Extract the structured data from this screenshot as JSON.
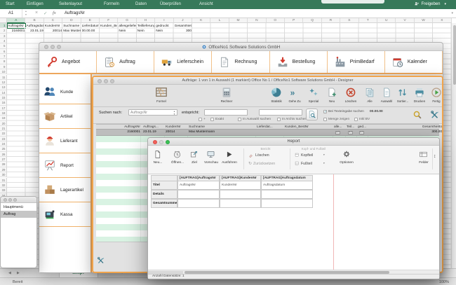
{
  "colors": {
    "ribbon_green": "#37795a",
    "accent_orange": "#f0a44c",
    "mint_stripe": "#d9f3e3",
    "excel_green": "#1e7145",
    "selection_gray": "#bdbdbd",
    "icon_teal": "#4a8da1",
    "page_guide_pink": "#f1b7b7"
  },
  "excel": {
    "ribbon_tabs": [
      "Start",
      "Einfügen",
      "Seitenlayout",
      "Formeln",
      "Daten",
      "Überprüfen",
      "Ansicht"
    ],
    "share_label": "Freigeben",
    "name_box": "A1",
    "formula_cancel": "×",
    "formula_enter": "✓",
    "formula_fx": "fx",
    "formula_value": "AuftragsNr",
    "columns": [
      "A",
      "B",
      "C",
      "D",
      "E",
      "F",
      "G",
      "H",
      "I",
      "J",
      "K",
      "L",
      "M",
      "N",
      "O",
      "P",
      "Q",
      "R",
      "S",
      "T",
      "U",
      "V",
      "W",
      "X"
    ],
    "row_count": 48,
    "sheet_header_row": [
      "AuftragsNr",
      "Auftragsdatu",
      "KundenNr",
      "Suchname",
      "Lieferdatum",
      "Kunden_Bes",
      "allesgeliefert",
      "Teillieferung",
      "gedruckt",
      "GesamtNetto"
    ],
    "sheet_data_row": [
      "2160001",
      "23.01.19",
      "20014",
      "Max Muster",
      "00.00.00",
      "",
      "Nein",
      "Nein",
      "Nein",
      "300"
    ],
    "sheet_tab": "temp7",
    "nav_prev": "◀",
    "nav_next": "▶",
    "add_sheet": "+",
    "status_ready": "Bereit",
    "zoom_level": "100%"
  },
  "main_window": {
    "title": "OfficeNo1 Software Solutions GmbH",
    "toolbar": [
      {
        "label": "Angebot",
        "icon": "key-icon"
      },
      {
        "label": "Auftrag",
        "icon": "clipboard-icon"
      },
      {
        "label": "Lieferschein",
        "icon": "truck-icon"
      },
      {
        "label": "Rechnung",
        "icon": "document-icon"
      },
      {
        "label": "Bestellung",
        "icon": "inbox-down-icon"
      },
      {
        "label": "PrimBedarf",
        "icon": "factory-icon"
      },
      {
        "label": "Kalender",
        "icon": "calendar-icon"
      }
    ],
    "sidebar": [
      {
        "label": "Kunde",
        "icon": "people-icon"
      },
      {
        "label": "Artikel",
        "icon": "open-box-icon"
      },
      {
        "label": "Lieferant",
        "icon": "person-cap-icon"
      },
      {
        "label": "Report",
        "icon": "chart-icon"
      },
      {
        "label": "Lagerartikel",
        "icon": "boxes-icon"
      },
      {
        "label": "Kassa",
        "icon": "cash-register-icon"
      }
    ]
  },
  "orders_window": {
    "title": "Aufträge: 1 von 1 in Auswahl  (1 markiert) Office No 1 /  OfficeNo1 Software Solutions GmbH - Designer",
    "toolbar_main": [
      {
        "label": "Formel",
        "icon": "abacus-icon"
      },
      {
        "label": "Rechner",
        "icon": "calculator-icon"
      }
    ],
    "toolbar_actions": [
      {
        "label": "Statistik",
        "icon": "pie-chart-icon"
      },
      {
        "label": "Gehe Zu",
        "icon": "goto-icon"
      },
      {
        "label": "Spezial",
        "icon": "stars-icon"
      },
      {
        "label": "Neu",
        "icon": "new-page-icon"
      },
      {
        "label": "Löschen",
        "icon": "delete-circle-icon"
      },
      {
        "label": "Alle",
        "icon": "pages-icon"
      },
      {
        "label": "Auswahl",
        "icon": "page-icon"
      },
      {
        "label": "Sortier...",
        "icon": "sort-icon"
      },
      {
        "label": "Drucken",
        "icon": "printer-icon"
      },
      {
        "label": "Fertig",
        "icon": "done-icon"
      }
    ],
    "search": {
      "label": "Suchen nach:",
      "field": "AuftragsNr",
      "operator": "entspricht:",
      "checks": [
        "+",
        "Exakt",
        "In Auswahl suchen",
        "In Archiv suchen"
      ],
      "opt_text_search": "Bei Texteingabe suchen",
      "opt_text_value": "00.00.00",
      "opt_menge": "Menge zeigen",
      "opt_inkl": "Inkl BV"
    },
    "table": {
      "headers": [
        "AuftragsNr",
        "Auftrags...",
        "KundenNr",
        "Suchname",
        "Lieferdat...",
        "Kunden_BestNr",
        "alle...",
        "Teil...",
        "ged...",
        "GesamtNetto"
      ],
      "row": [
        "2160001",
        "23.01.19",
        "20014",
        "Max Mustermann",
        "",
        "",
        "",
        "",
        "",
        "300,00"
      ]
    }
  },
  "report_window": {
    "title": "Report",
    "toolbar": [
      {
        "label": "Neu...",
        "icon": "new-doc-icon"
      },
      {
        "label": "Öffnen...",
        "icon": "clock-icon"
      },
      {
        "label": "Ziel",
        "icon": "target-icon"
      },
      {
        "label": "Vorschau",
        "icon": "monitor-icon"
      },
      {
        "label": "Ausführen",
        "icon": "run-icon"
      }
    ],
    "group_report": {
      "label": "Bericht",
      "item_delete": "Löschen",
      "item_reset": "Zurücksetzen"
    },
    "group_headfoot": {
      "label": "Kopf- und Fußteil",
      "item_head": "Kopfteil",
      "item_foot": "Fußteil"
    },
    "options_label": "Optionen",
    "fields_label": "Felder",
    "grid": {
      "headers": [
        "[AUFTRAG]AuftragsNr",
        "[AUFTRAG]KundenNr",
        "[AUFTRAG]Auftragsdatum"
      ],
      "rows": [
        {
          "label": "Titel",
          "cells": [
            "AuftragsNr",
            "KundenNr",
            "Auftragsdatum"
          ]
        },
        {
          "label": "Details",
          "cells": [
            "",
            "",
            ""
          ]
        },
        {
          "label": "Gesamtsumme",
          "cells": [
            "",
            "",
            ""
          ]
        }
      ]
    },
    "status": "Anzahl Datensätze: 1"
  },
  "menu_window": {
    "rows": [
      {
        "label": "Hauptmenü",
        "selected": false
      },
      {
        "label": "Auftrag",
        "selected": true
      }
    ]
  }
}
